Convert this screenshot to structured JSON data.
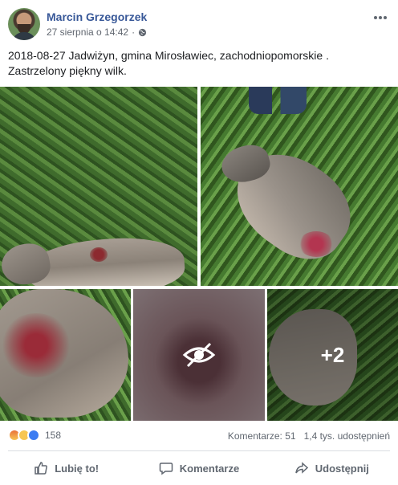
{
  "post": {
    "author": "Marcin Grzegorzek",
    "timestamp": "27 sierpnia o 14:42",
    "privacy_icon": "globe-icon",
    "text": "2018-08-27 Jadwiżyn, gmina Mirosławiec, zachodniopomorskie . Zastrzelony piękny wilk."
  },
  "photos": {
    "hidden_icon": "eye-slash-icon",
    "more_count": "+2"
  },
  "stats": {
    "reactions": [
      "angry",
      "sad",
      "like"
    ],
    "reaction_count": "158",
    "comments": "Komentarze: 51",
    "shares": "1,4 tys. udostępnień"
  },
  "actions": {
    "like": "Lubię to!",
    "comment": "Komentarze",
    "share": "Udostępnij"
  },
  "colors": {
    "author_link": "#385898",
    "meta_text": "#616770",
    "action_text": "#606770",
    "like_blue": "#3b7cf2"
  }
}
